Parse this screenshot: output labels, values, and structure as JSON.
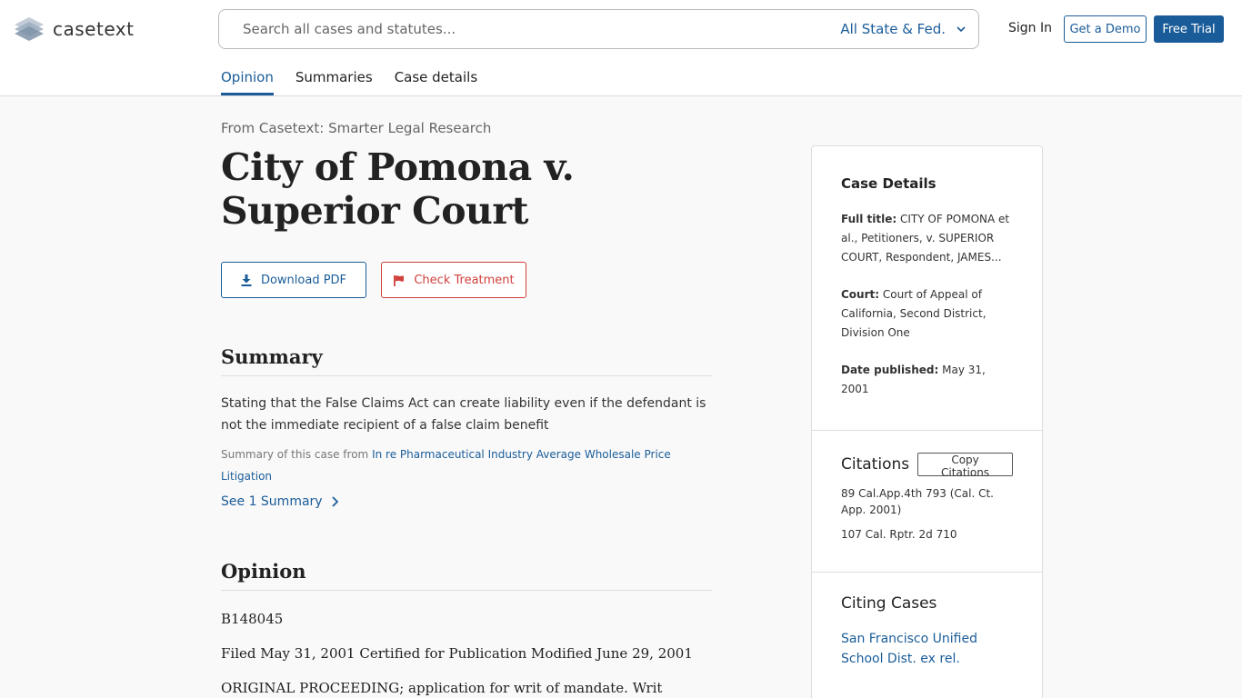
{
  "header": {
    "logo_text": "casetext",
    "search_placeholder": "Search all cases and statutes...",
    "jurisdiction": "All State & Fed.",
    "sign_in": "Sign In",
    "get_demo": "Get a Demo",
    "free_trial": "Free Trial"
  },
  "tabs": [
    {
      "label": "Opinion",
      "active": true
    },
    {
      "label": "Summaries"
    },
    {
      "label": "Case details"
    }
  ],
  "main": {
    "from_line": "From Casetext: Smarter Legal Research",
    "title": "City of Pomona v. Superior Court",
    "download_pdf": "Download PDF",
    "check_treatment": "Check Treatment",
    "summary_heading": "Summary",
    "summary_text": "Stating that the False Claims Act can create liability even if the defendant is not the immediate recipient of a false claim benefit",
    "summary_source_prefix": "Summary of this case from",
    "summary_source_link": "In re Pharmaceutical Industry Average Wholesale Price Litigation",
    "see_summary": "See 1 Summary",
    "opinion_heading": "Opinion",
    "opinion_lines": [
      "B148045",
      "Filed May 31, 2001 Certified for Publication Modified June 29, 2001",
      "ORIGINAL PROCEEDING; application for writ of mandate. Writ"
    ]
  },
  "sidebar": {
    "case_details_heading": "Case Details",
    "full_title_label": "Full title:",
    "full_title_value": "CITY OF POMONA et al., Petitioners, v. SUPERIOR COURT, Respondent, JAMES...",
    "court_label": "Court:",
    "court_value": "Court of Appeal of California, Second District, Division One",
    "date_label": "Date published:",
    "date_value": "May 31, 2001",
    "citations_heading": "Citations",
    "copy_citations": "Copy Citations",
    "citations": [
      "89 Cal.App.4th 793 (Cal. Ct. App. 2001)",
      "107 Cal. Rptr. 2d 710"
    ],
    "citing_heading": "Citing Cases",
    "citing_case": "San Francisco Unified School Dist. ex rel."
  },
  "colors": {
    "brand_blue": "#1a5c99",
    "treatment_red": "#d0413c"
  }
}
